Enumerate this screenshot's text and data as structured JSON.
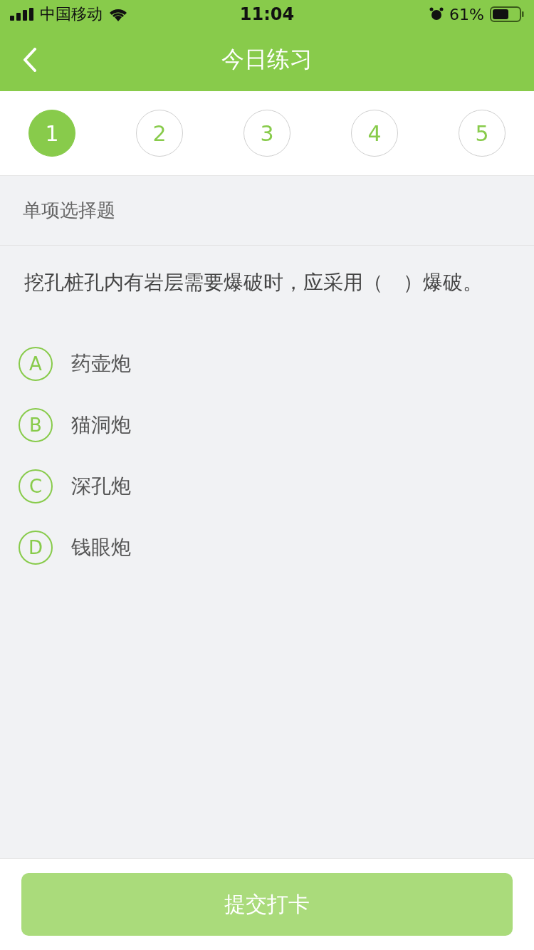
{
  "status_bar": {
    "carrier": "中国移动",
    "time": "11:04",
    "battery": "61%"
  },
  "nav": {
    "title": "今日练习"
  },
  "steps": [
    {
      "label": "1",
      "selected": true
    },
    {
      "label": "2",
      "selected": false
    },
    {
      "label": "3",
      "selected": false
    },
    {
      "label": "4",
      "selected": false
    },
    {
      "label": "5",
      "selected": false
    }
  ],
  "question": {
    "type": "单项选择题",
    "text": "挖孔桩孔内有岩层需要爆破时，应采用（　）爆破。",
    "options": [
      {
        "letter": "A",
        "text": "药壶炮",
        "selected": false
      },
      {
        "letter": "B",
        "text": "猫洞炮",
        "selected": false
      },
      {
        "letter": "C",
        "text": "深孔炮",
        "selected": false
      },
      {
        "letter": "D",
        "text": "钱眼炮",
        "selected": false
      }
    ]
  },
  "submit": {
    "label": "提交打卡",
    "disabled": true
  }
}
